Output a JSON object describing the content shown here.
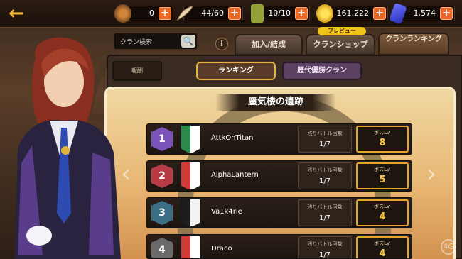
{
  "resources": [
    {
      "icon": "medal-icon",
      "value": "0"
    },
    {
      "icon": "feather-icon",
      "value": "44/60"
    },
    {
      "icon": "ticket-icon",
      "value": "10/10"
    },
    {
      "icon": "coin-icon",
      "value": "161,222"
    },
    {
      "icon": "gem-icon",
      "value": "1,574"
    }
  ],
  "plus_label": "+",
  "search": {
    "label": "クラン検索"
  },
  "info_label": "i",
  "tabs": {
    "join": "加入/結成",
    "shop": "クランショップ",
    "shop_badge": "プレビュー",
    "ranking": "クランランキング"
  },
  "reward_label": "報酬",
  "segments": {
    "ranking": "ランキング",
    "history": "歴代優勝クラン"
  },
  "stage_title": "蜃気楼の遺跡",
  "colors": {
    "accent": "#e7a427",
    "plus": "#e9682a"
  },
  "rows": [
    {
      "rank": "1",
      "name": "AttkOnTitan",
      "remain_label": "残りバトル回数",
      "remain": "1/7",
      "boss_label": "ボスLv.",
      "boss": "8",
      "badge_color": "#7a52b8",
      "emblem_main": "#2a8a4a",
      "emblem_accent": "#ffffff"
    },
    {
      "rank": "2",
      "name": "AlphaLantern",
      "remain_label": "残りバトル回数",
      "remain": "1/7",
      "boss_label": "ボスLv.",
      "boss": "5",
      "badge_color": "#b73a45",
      "emblem_main": "#d23a3a",
      "emblem_accent": "#ffffff"
    },
    {
      "rank": "3",
      "name": "Va1k4rie",
      "remain_label": "残りバトル回数",
      "remain": "1/7",
      "boss_label": "ボスLv.",
      "boss": "4",
      "badge_color": "#3b6f86",
      "emblem_main": "#1d1d1d",
      "emblem_accent": "#f2f2f2"
    },
    {
      "rank": "4",
      "name": "Draco",
      "remain_label": "残りバトル回数",
      "remain": "1/7",
      "boss_label": "ボスLv.",
      "boss": "4",
      "badge_color": "#6a6a6a",
      "emblem_main": "#d23a3a",
      "emblem_accent": "#ffffff"
    }
  ]
}
